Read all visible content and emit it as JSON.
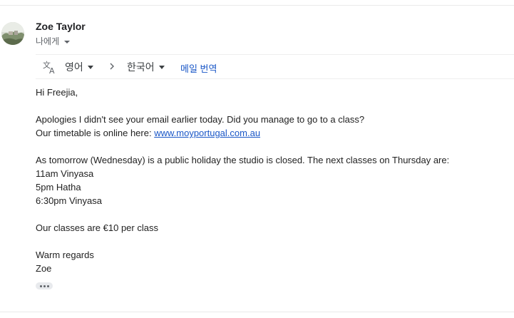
{
  "sender": {
    "name": "Zoe Taylor"
  },
  "recipient": {
    "label": "나에게"
  },
  "translate_bar": {
    "source_language": "영어",
    "target_language": "한국어",
    "translate_message": "메일 번역"
  },
  "message": {
    "greeting": "Hi Freejia,",
    "line1": "Apologies I didn't see your email earlier today. Did you manage to go to a class?",
    "line2_prefix": "Our timetable is online here: ",
    "timetable_link": "www.moyportugal.com.au",
    "line3": "As tomorrow (Wednesday) is a public holiday the studio is closed. The next classes on Thursday are:",
    "classes": [
      "11am Vinyasa",
      "5pm Hatha",
      "6:30pm Vinyasa"
    ],
    "price": "Our classes are €10 per class",
    "signoff": "Warm regards",
    "signature": "Zoe"
  },
  "icons": {
    "avatar": "avatar-photo",
    "translate": "translate-icon",
    "arrow": "chevron-right-icon",
    "expand": "more-horiz-icon"
  },
  "colors": {
    "link": "#1a57c7",
    "text": "#222222",
    "secondary_text": "#5f6368"
  }
}
